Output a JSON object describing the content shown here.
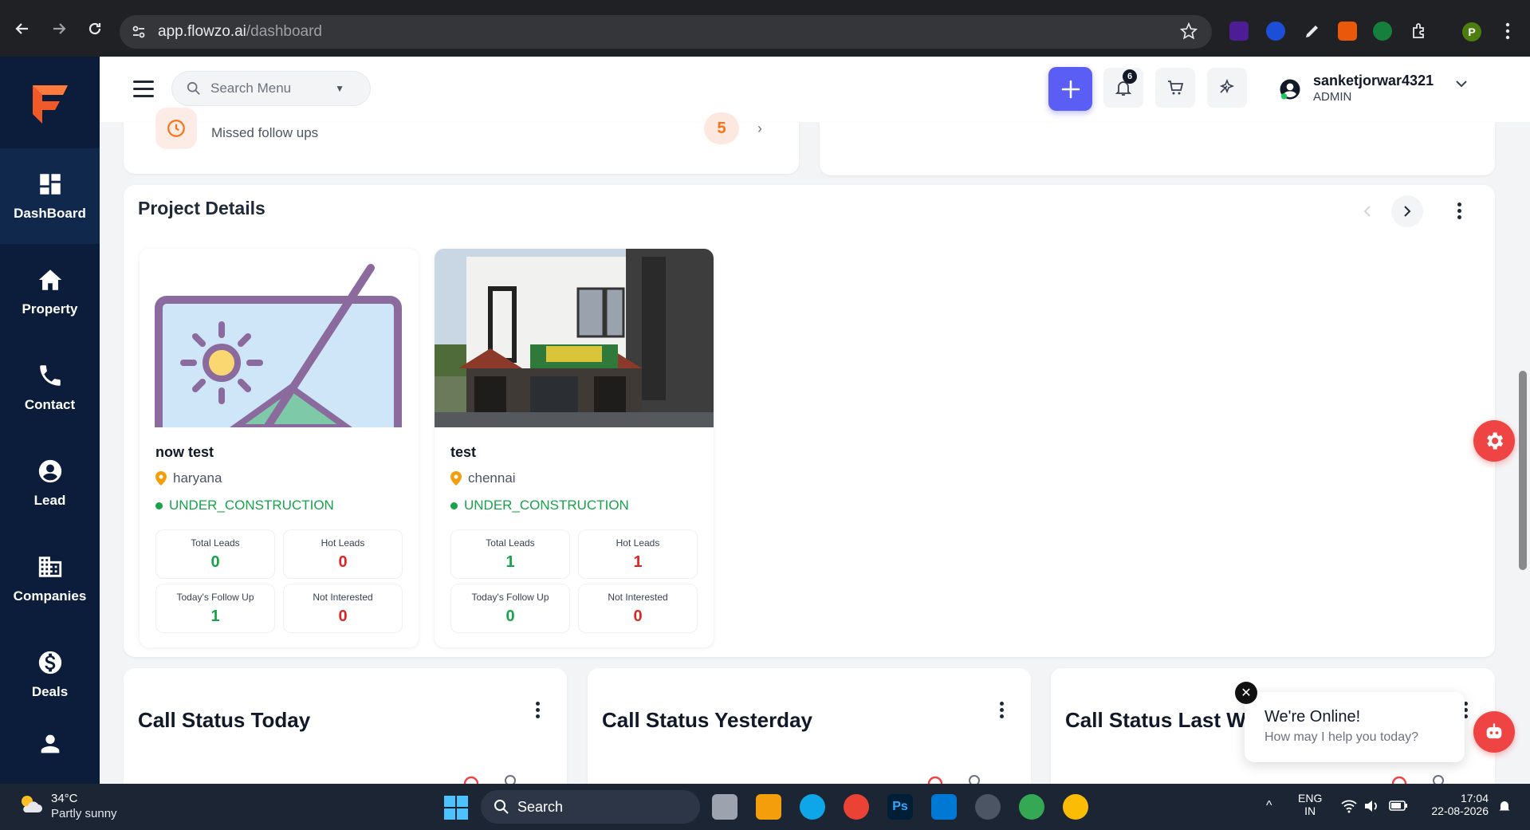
{
  "browser": {
    "url_domain": "app.flowzo.ai",
    "url_path": "/dashboard",
    "profile_initial": "P"
  },
  "sidebar": {
    "items": [
      {
        "label": "DashBoard",
        "icon": "dashboard-icon"
      },
      {
        "label": "Property",
        "icon": "home-icon"
      },
      {
        "label": "Contact",
        "icon": "phone-icon"
      },
      {
        "label": "Lead",
        "icon": "user-circle-icon"
      },
      {
        "label": "Companies",
        "icon": "building-icon"
      },
      {
        "label": "Deals",
        "icon": "dollar-icon"
      },
      {
        "label": "",
        "icon": "person-icon"
      }
    ]
  },
  "header": {
    "search_placeholder": "Search Menu",
    "notification_count": "6",
    "user_name": "sanketjorwar4321",
    "user_role": "ADMIN"
  },
  "followups": {
    "missed_label": "Missed follow ups",
    "missed_count": "5"
  },
  "projects": {
    "title": "Project Details",
    "cards": [
      {
        "name": "now test",
        "location": "haryana",
        "status": "UNDER_CONSTRUCTION",
        "stats": [
          {
            "label": "Total Leads",
            "value": "0"
          },
          {
            "label": "Hot Leads",
            "value": "0"
          },
          {
            "label": "Today's Follow Up",
            "value": "1"
          },
          {
            "label": "Not Interested",
            "value": "0"
          }
        ]
      },
      {
        "name": "test",
        "location": "chennai",
        "status": "UNDER_CONSTRUCTION",
        "stats": [
          {
            "label": "Total Leads",
            "value": "1"
          },
          {
            "label": "Hot Leads",
            "value": "1"
          },
          {
            "label": "Today's Follow Up",
            "value": "0"
          },
          {
            "label": "Not Interested",
            "value": "0"
          }
        ]
      }
    ]
  },
  "call_status": {
    "today_title": "Call Status Today",
    "yesterday_title": "Call Status Yesterday",
    "last_week_title": "Call Status Last Week"
  },
  "chat": {
    "title": "We're Online!",
    "subtitle": "How may I help you today?"
  },
  "taskbar": {
    "temperature": "34°C",
    "weather": "Partly sunny",
    "search_label": "Search",
    "lang": "ENG",
    "region": "IN",
    "time": "17:04",
    "date": "22-08-2026"
  },
  "colors": {
    "sidebar_bg": "#0b1d3a",
    "accent": "#5b5ef4",
    "success": "#16a34a",
    "danger": "#dc2626"
  }
}
